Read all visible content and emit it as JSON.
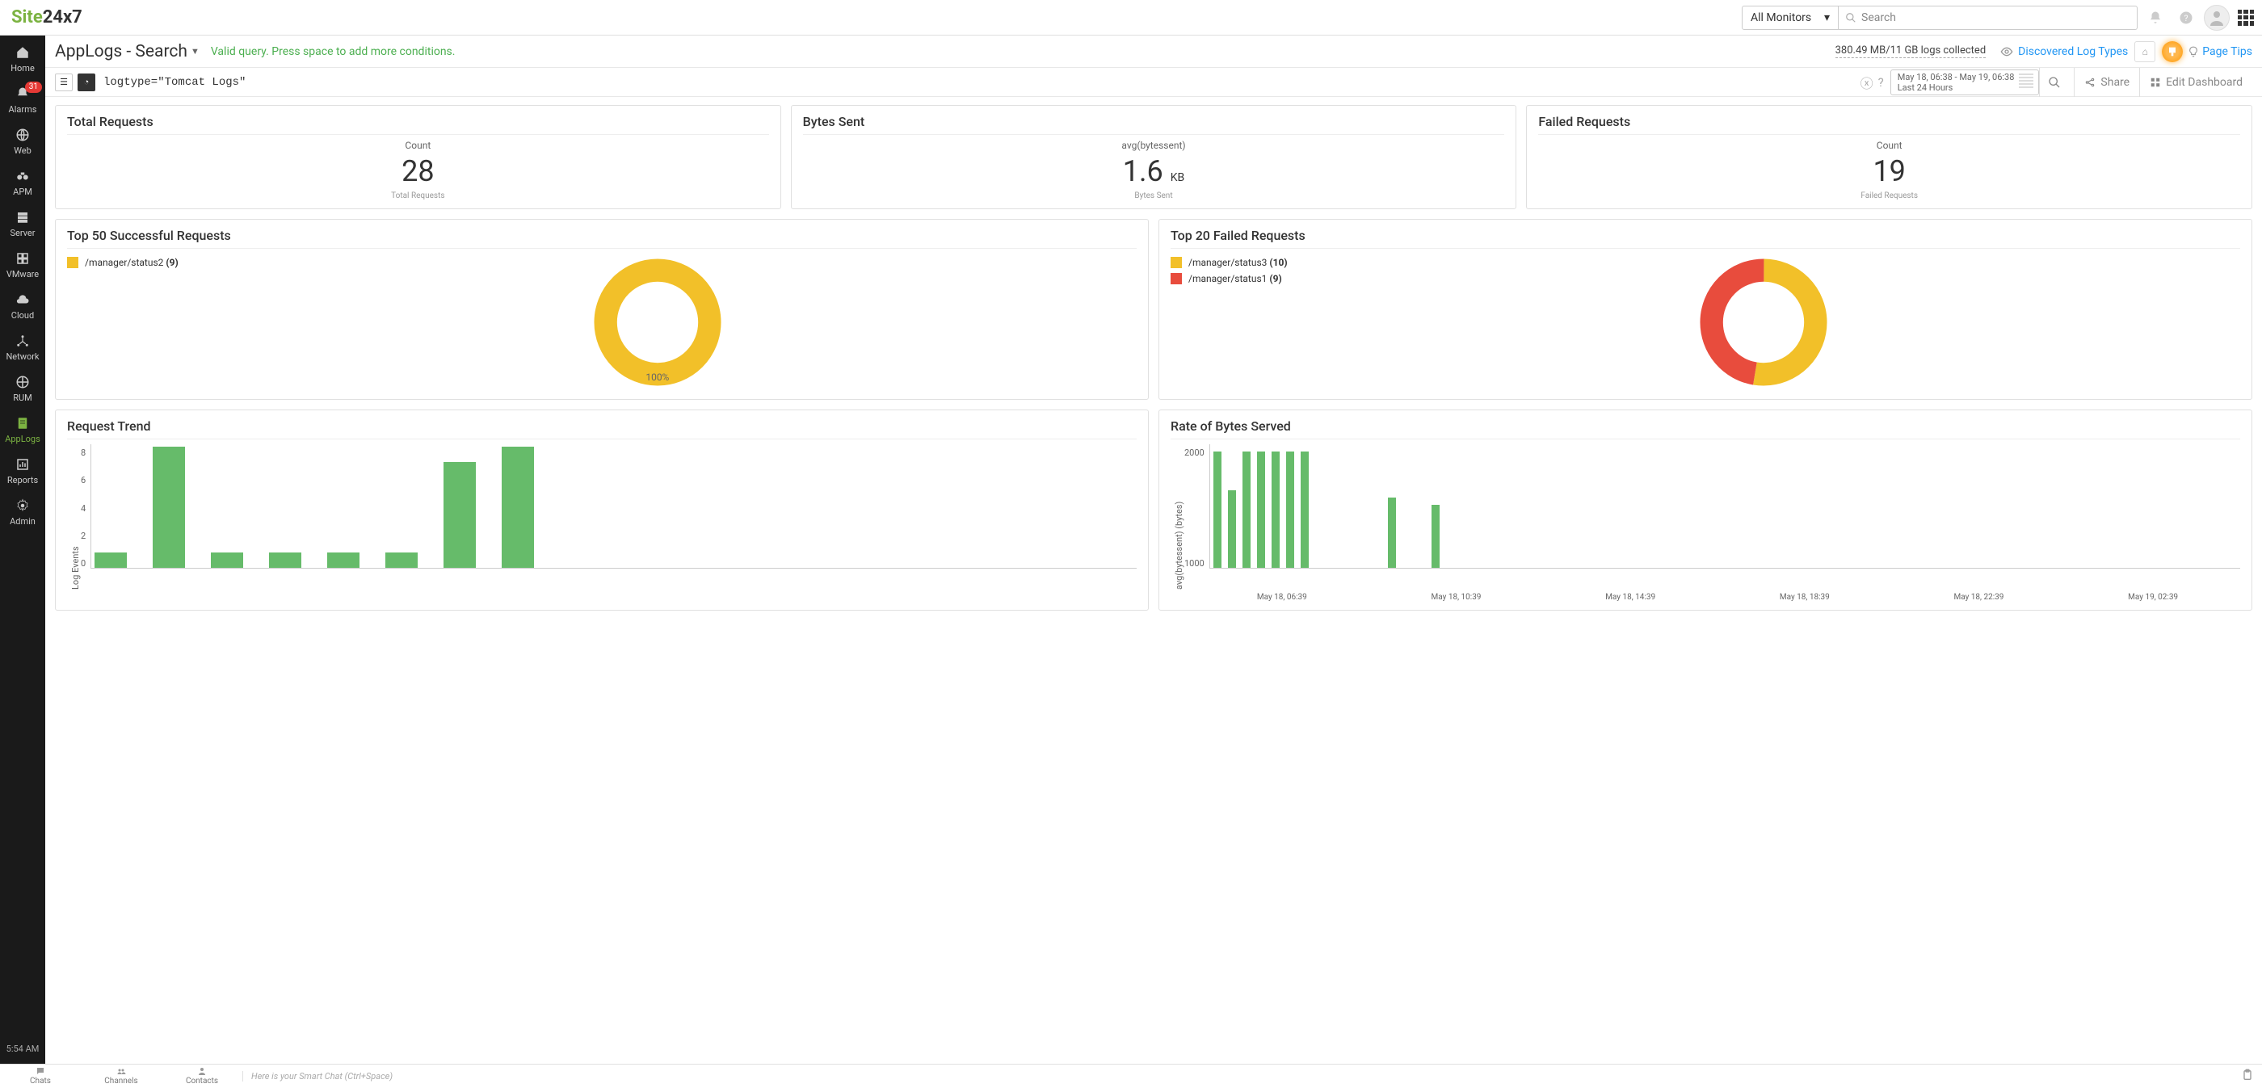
{
  "brand": {
    "part1": "Site",
    "part2": "24x7"
  },
  "topbar": {
    "monitor_select": "All Monitors",
    "search_placeholder": "Search"
  },
  "sidebar": {
    "items": [
      {
        "label": "Home"
      },
      {
        "label": "Alarms",
        "badge": "31"
      },
      {
        "label": "Web"
      },
      {
        "label": "APM"
      },
      {
        "label": "Server"
      },
      {
        "label": "VMware"
      },
      {
        "label": "Cloud"
      },
      {
        "label": "Network"
      },
      {
        "label": "RUM"
      },
      {
        "label": "AppLogs"
      },
      {
        "label": "Reports"
      },
      {
        "label": "Admin"
      }
    ],
    "time": "5:54 AM"
  },
  "page": {
    "title": "AppLogs - Search",
    "valid_query": "Valid query. Press space to add more conditions.",
    "logs_collected": "380.49 MB/11 GB logs collected",
    "discovered": "Discovered Log Types",
    "page_tips": "Page Tips"
  },
  "querybar": {
    "query": "logtype=\"Tomcat Logs\"",
    "date_line1": "May 18, 06:38 - May 19, 06:38",
    "date_line2": "Last 24 Hours",
    "share": "Share",
    "edit": "Edit Dashboard"
  },
  "cards": {
    "total_requests": {
      "title": "Total Requests",
      "sub": "Count",
      "value": "28",
      "foot": "Total Requests"
    },
    "bytes_sent": {
      "title": "Bytes Sent",
      "sub": "avg(bytessent)",
      "value": "1.6",
      "unit": "KB",
      "foot": "Bytes Sent"
    },
    "failed_requests": {
      "title": "Failed Requests",
      "sub": "Count",
      "value": "19",
      "foot": "Failed Requests"
    },
    "top_success": {
      "title": "Top 50 Successful Requests",
      "legend": [
        {
          "label": "/manager/status2",
          "count": "(9)",
          "color": "#f2c029"
        }
      ],
      "center_label": "100%"
    },
    "top_failed": {
      "title": "Top 20 Failed Requests",
      "legend": [
        {
          "label": "/manager/status3",
          "count": "(10)",
          "color": "#f2c029"
        },
        {
          "label": "/manager/status1",
          "count": "(9)",
          "color": "#e84c3d"
        }
      ]
    },
    "request_trend": {
      "title": "Request Trend",
      "ylabel": "Log Events"
    },
    "bytes_rate": {
      "title": "Rate of Bytes Served",
      "ylabel": "avg(bytessent) (bytes)"
    }
  },
  "chart_data": [
    {
      "type": "bar",
      "id": "request_trend",
      "title": "Request Trend",
      "ylabel": "Log Events",
      "ylim": [
        0,
        8
      ],
      "yticks": [
        0,
        2,
        4,
        6,
        8
      ],
      "categories": [
        "",
        "",
        "",
        "",
        "",
        "",
        "",
        "",
        "",
        ""
      ],
      "values": [
        1,
        8,
        1,
        1,
        1,
        1,
        7,
        8,
        0,
        0
      ]
    },
    {
      "type": "bar",
      "id": "bytes_rate",
      "title": "Rate of Bytes Served",
      "ylabel": "avg(bytessent) (bytes)",
      "ylim": [
        0,
        2500
      ],
      "yticks": [
        1000,
        2000
      ],
      "xticks": [
        "May 18, 06:39",
        "May 18, 10:39",
        "May 18, 14:39",
        "May 18, 18:39",
        "May 18, 22:39",
        "May 19, 02:39"
      ],
      "values": [
        2400,
        1600,
        2400,
        2400,
        2400,
        2400,
        2400,
        0,
        0,
        0,
        0,
        0,
        1450,
        0,
        0,
        1300,
        0,
        0,
        0,
        0,
        0,
        0
      ]
    },
    {
      "type": "pie",
      "id": "top_success",
      "title": "Top 50 Successful Requests",
      "series": [
        {
          "name": "/manager/status2",
          "value": 9,
          "color": "#f2c029"
        }
      ]
    },
    {
      "type": "pie",
      "id": "top_failed",
      "title": "Top 20 Failed Requests",
      "series": [
        {
          "name": "/manager/status3",
          "value": 10,
          "color": "#f2c029"
        },
        {
          "name": "/manager/status1",
          "value": 9,
          "color": "#e84c3d"
        }
      ]
    }
  ],
  "bottombar": {
    "chats": "Chats",
    "channels": "Channels",
    "contacts": "Contacts",
    "smart_chat": "Here is your Smart Chat (Ctrl+Space)"
  }
}
